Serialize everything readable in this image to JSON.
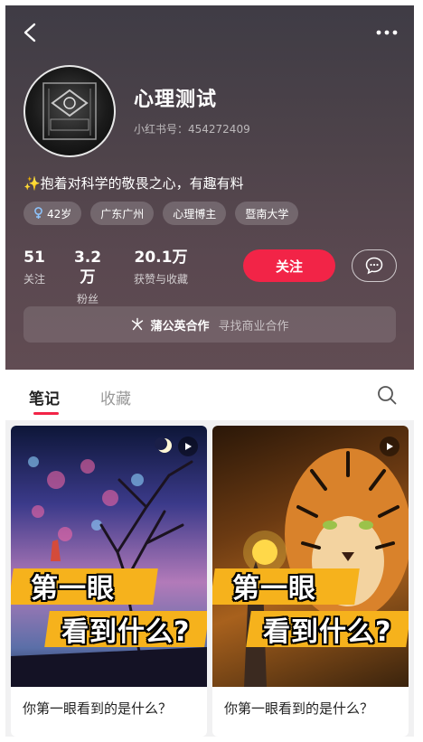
{
  "profile": {
    "name": "心理测试",
    "red_id": "小红书号：454272409",
    "bio": "✨抱着对科学的敬畏之心，有趣有料",
    "tags": [
      "42岁",
      "广东广州",
      "心理博主",
      "暨南大学"
    ],
    "stats": [
      {
        "num": "51",
        "label": "关注"
      },
      {
        "num": "3.2万",
        "label": "粉丝"
      },
      {
        "num": "20.1万",
        "label": "获赞与收藏"
      }
    ],
    "follow_label": "关注"
  },
  "biz": {
    "title": "蒲公英合作",
    "subtitle": "寻找商业合作"
  },
  "tabs": {
    "notes": "笔记",
    "collect": "收藏"
  },
  "notes": [
    {
      "title": "你第一眼看到的是什么？",
      "overlay1": "第一眼",
      "overlay2": "看到什么?"
    },
    {
      "title": "你第一眼看到的是什么？",
      "overlay1": "第一眼",
      "overlay2": "看到什么?"
    }
  ],
  "icons": [
    "back-icon",
    "more-icon",
    "female-icon",
    "message-icon",
    "dandelion-icon",
    "search-icon",
    "play-icon"
  ],
  "colors": {
    "accent": "#f22447",
    "header_bg": "#4e434a"
  }
}
